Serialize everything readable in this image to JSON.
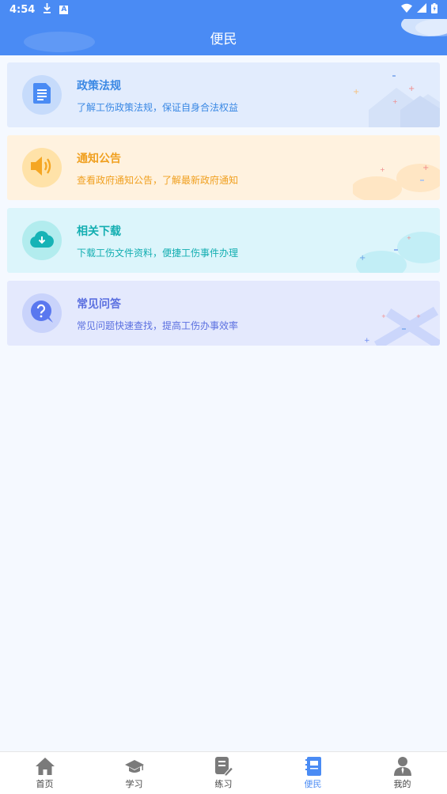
{
  "status_bar": {
    "time": "4:54",
    "a_glyph": "A"
  },
  "header": {
    "title": "便民"
  },
  "cards": [
    {
      "title": "政策法规",
      "desc": "了解工伤政策法规，保证自身合法权益",
      "icon": "document-icon",
      "bg": "#e2ecfd",
      "circle": "#c6dbfb",
      "icon_color": "#4a8bf4",
      "title_color": "#3a88e4",
      "desc_color": "#3a88e4"
    },
    {
      "title": "通知公告",
      "desc": "查看政府通知公告，了解最新政府通知",
      "icon": "speaker-icon",
      "bg": "#fff2df",
      "circle": "#ffe2a8",
      "icon_color": "#f5a623",
      "title_color": "#f0a020",
      "desc_color": "#f0a020"
    },
    {
      "title": "相关下载",
      "desc": "下载工伤文件资料，便捷工伤事件办理",
      "icon": "cloud-download-icon",
      "bg": "#dcf5fb",
      "circle": "#b2ecee",
      "icon_color": "#17b3b6",
      "title_color": "#13aeb1",
      "desc_color": "#13aeb1"
    },
    {
      "title": "常见问答",
      "desc": "常见问题快速查找，提高工伤办事效率",
      "icon": "question-icon",
      "bg": "#e4e9fd",
      "circle": "#c9d3fb",
      "icon_color": "#5a78ef",
      "title_color": "#5a6fe0",
      "desc_color": "#5a6fe0"
    }
  ],
  "nav": {
    "items": [
      {
        "label": "首页",
        "icon": "home-icon"
      },
      {
        "label": "学习",
        "icon": "graduation-cap-icon"
      },
      {
        "label": "练习",
        "icon": "edit-note-icon"
      },
      {
        "label": "便民",
        "icon": "notebook-icon"
      },
      {
        "label": "我的",
        "icon": "person-icon"
      }
    ],
    "active": "便民",
    "active_color": "#4a8bf4",
    "inactive_color": "#7a7a7a"
  }
}
